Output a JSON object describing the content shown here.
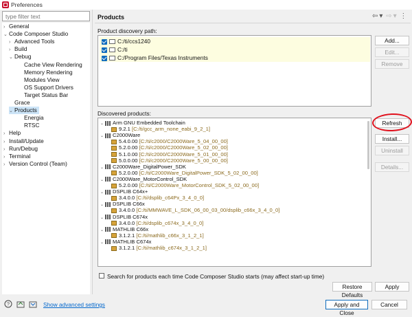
{
  "window": {
    "title": "Preferences"
  },
  "filter": {
    "placeholder": "type filter text"
  },
  "tree": [
    {
      "label": "General",
      "arrow": "›"
    },
    {
      "label": "Code Composer Studio",
      "arrow": "⌄"
    },
    {
      "label": "Advanced Tools",
      "arrow": "›"
    },
    {
      "label": "Build",
      "arrow": "›"
    },
    {
      "label": "Debug",
      "arrow": "⌄"
    },
    {
      "label": "Cache View Rendering",
      "arrow": ""
    },
    {
      "label": "Memory Rendering",
      "arrow": ""
    },
    {
      "label": "Modules View",
      "arrow": ""
    },
    {
      "label": "OS Support Drivers",
      "arrow": ""
    },
    {
      "label": "Target Status Bar",
      "arrow": ""
    },
    {
      "label": "Grace",
      "arrow": ""
    },
    {
      "label": "Products",
      "arrow": "⌄"
    },
    {
      "label": "Energia",
      "arrow": ""
    },
    {
      "label": "RTSC",
      "arrow": ""
    },
    {
      "label": "Help",
      "arrow": "›"
    },
    {
      "label": "Install/Update",
      "arrow": "›"
    },
    {
      "label": "Run/Debug",
      "arrow": "›"
    },
    {
      "label": "Terminal",
      "arrow": "›"
    },
    {
      "label": "Version Control (Team)",
      "arrow": "›"
    }
  ],
  "page": {
    "heading": "Products",
    "discovery_label": "Product discovery path:",
    "paths": [
      "C:/ti/ccs1240",
      "C:/ti",
      "C:/Program Files/Texas Instruments"
    ],
    "path_buttons": {
      "add": "Add...",
      "edit": "Edit...",
      "remove": "Remove"
    },
    "discovered_label": "Discovered products:",
    "product_buttons": {
      "refresh": "Refresh",
      "install": "Install...",
      "uninstall": "Uninstall",
      "details": "Details..."
    },
    "products": [
      {
        "name": "Arm GNU Embedded Toolchain",
        "versions": [
          {
            "ver": "9.2.1",
            "loc": "[C:/ti/gcc_arm_none_eabi_9_2_1]"
          }
        ]
      },
      {
        "name": "C2000Ware",
        "versions": [
          {
            "ver": "5.4.0.00",
            "loc": "[C:/ti/c2000/C2000Ware_5_04_00_00]"
          },
          {
            "ver": "5.2.0.00",
            "loc": "[C:/ti/c2000/C2000Ware_5_02_00_00]"
          },
          {
            "ver": "5.1.0.00",
            "loc": "[C:/ti/c2000/C2000Ware_5_01_00_00]"
          },
          {
            "ver": "5.0.0.00",
            "loc": "[C:/ti/c2000/C2000Ware_5_00_00_00]"
          }
        ]
      },
      {
        "name": "C2000Ware_DigitalPower_SDK",
        "versions": [
          {
            "ver": "5.2.0.00",
            "loc": "[C:/ti/C2000Ware_DigitalPower_SDK_5_02_00_00]"
          }
        ]
      },
      {
        "name": "C2000Ware_MotorControl_SDK",
        "versions": [
          {
            "ver": "5.2.0.00",
            "loc": "[C:/ti/C2000Ware_MotorControl_SDK_5_02_00_00]"
          }
        ]
      },
      {
        "name": "DSPLIB C64x+",
        "versions": [
          {
            "ver": "3.4.0.0",
            "loc": "[C:/ti/dsplib_c64Px_3_4_0_0]"
          }
        ]
      },
      {
        "name": "DSPLIB C66x",
        "versions": [
          {
            "ver": "3.4.0.0",
            "loc": "[C:/ti/MMWAVE_L_SDK_06_00_03_00/dsplib_c66x_3_4_0_0]"
          }
        ]
      },
      {
        "name": "DSPLIB C674x",
        "versions": [
          {
            "ver": "3.4.0.0",
            "loc": "[C:/ti/dsplib_c674x_3_4_0_0]"
          }
        ]
      },
      {
        "name": "MATHLIB C66x",
        "versions": [
          {
            "ver": "3.1.2.1",
            "loc": "[C:/ti/mathlib_c66x_3_1_2_1]"
          }
        ]
      },
      {
        "name": "MATHLIB C674x",
        "versions": [
          {
            "ver": "3.1.2.1",
            "loc": "[C:/ti/mathlib_c674x_3_1_2_1]"
          }
        ]
      }
    ],
    "search_label": "Search for products each time Code Composer Studio starts (may affect start-up time)",
    "restore_defaults": "Restore Defaults",
    "apply": "Apply"
  },
  "bottom": {
    "show_advanced": "Show advanced settings",
    "apply_and_close": "Apply and Close",
    "cancel": "Cancel"
  },
  "colors": {
    "accent": "#0f6cbd",
    "annotation": "#e0101c",
    "location_text": "#8b6a1e",
    "link": "#0066cc"
  }
}
